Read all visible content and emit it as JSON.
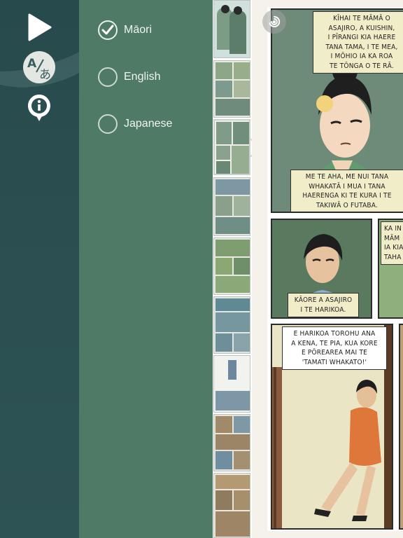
{
  "toolbar": {
    "play": {
      "icon": "play-icon"
    },
    "translate": {
      "icon": "translate-icon"
    },
    "info": {
      "icon": "info-icon"
    }
  },
  "language_panel": {
    "options": [
      {
        "label": "Māori",
        "selected": true
      },
      {
        "label": "English",
        "selected": false
      },
      {
        "label": "Japanese",
        "selected": false
      }
    ]
  },
  "comic": {
    "panel1_caption_top": "KĪHAI TE MĀMĀ O\nASAJIRO, A KUISHIN,\nI PĪRANGI KIA HAERE\nTANA TAMA, I TE MEA,\nI MŌHIO IA KA ROA\nTE TŌNGA O TE RĀ.",
    "panel1_caption_bottom": "ME TE AHA, ME NUI TANA\nWHAKATĀ I MUA I TANA\nHAERENGA KI TE KURA I TE\nTAKIWĀ O FUTABA.",
    "panel2_caption": "KĀORE A ASAJIRO\nI TE HARIKOA.",
    "panel3_caption_partial": "KA IN\nMĀM\nIA KIA\nTAHA",
    "panel4_caption": "E HARIKOA TOROHU ANA\nA KENA, TE PIA, KUA KORE\nE PŌREAREA MAI TE\n'TAMATI WHAKATO!'"
  },
  "colors": {
    "toolbar_bg": "#2b4f51",
    "panel_bg": "#4e7a66",
    "caption_bg": "#f1edc8"
  }
}
